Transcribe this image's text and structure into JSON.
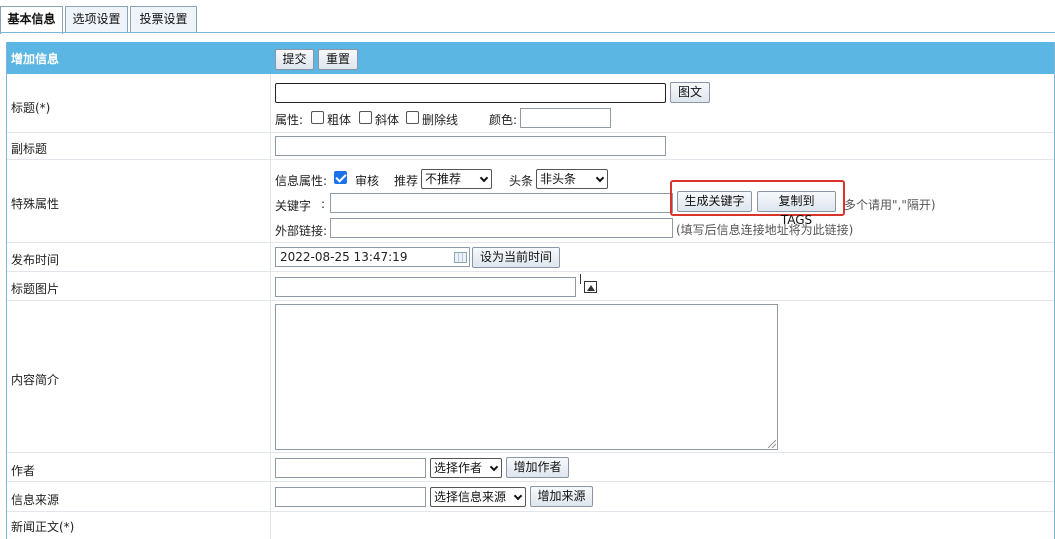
{
  "tabs": [
    "基本信息",
    "选项设置",
    "投票设置"
  ],
  "header": {
    "title": "增加信息",
    "submit_label": "提交",
    "reset_label": "重置"
  },
  "title_row": {
    "label": "标题(*)",
    "value": "",
    "pic_text_button": "图文",
    "attr_label": "属性:",
    "bold_label": "粗体",
    "italic_label": "斜体",
    "strike_label": "删除线",
    "color_label": "颜色:",
    "color_value": ""
  },
  "subtitle_row": {
    "label": "副标题",
    "value": ""
  },
  "special_row": {
    "label": "特殊属性",
    "info_attr_label": "信息属性:",
    "review_label": "审核",
    "review_checked": true,
    "recommend_label": "推荐",
    "recommend_value": "不推荐",
    "headline_label": "头条",
    "headline_value": "非头条",
    "keywords_label": "关键字",
    "keywords_colon": ":",
    "keywords_value": "",
    "gen_keywords_button": "生成关键字",
    "copy_tags_button": "复制到TAGS",
    "keywords_note": "多个请用\",\"隔开)",
    "external_link_label": "外部链接:",
    "external_link_value": "",
    "external_link_note": "(填写后信息连接地址将为此链接)"
  },
  "publish_row": {
    "label": "发布时间",
    "value": "2022-08-25 13:47:19",
    "set_now_button": "设为当前时间"
  },
  "title_image_row": {
    "label": "标题图片",
    "value": ""
  },
  "summary_row": {
    "label": "内容简介",
    "value": ""
  },
  "author_row": {
    "label": "作者",
    "value": "",
    "select_value": "选择作者",
    "add_button": "增加作者"
  },
  "source_row": {
    "label": "信息来源",
    "value": "",
    "select_value": "选择信息来源",
    "add_button": "增加来源"
  },
  "body_row": {
    "label": "新闻正文(*)"
  },
  "colors": {
    "header_bg": "#5cb6e3",
    "highlight_border": "#d9342b",
    "checkbox_checked": "#1a73e8"
  },
  "icons": [
    "calendar-icon",
    "image-picker-icon",
    "chevron-down-icon"
  ]
}
